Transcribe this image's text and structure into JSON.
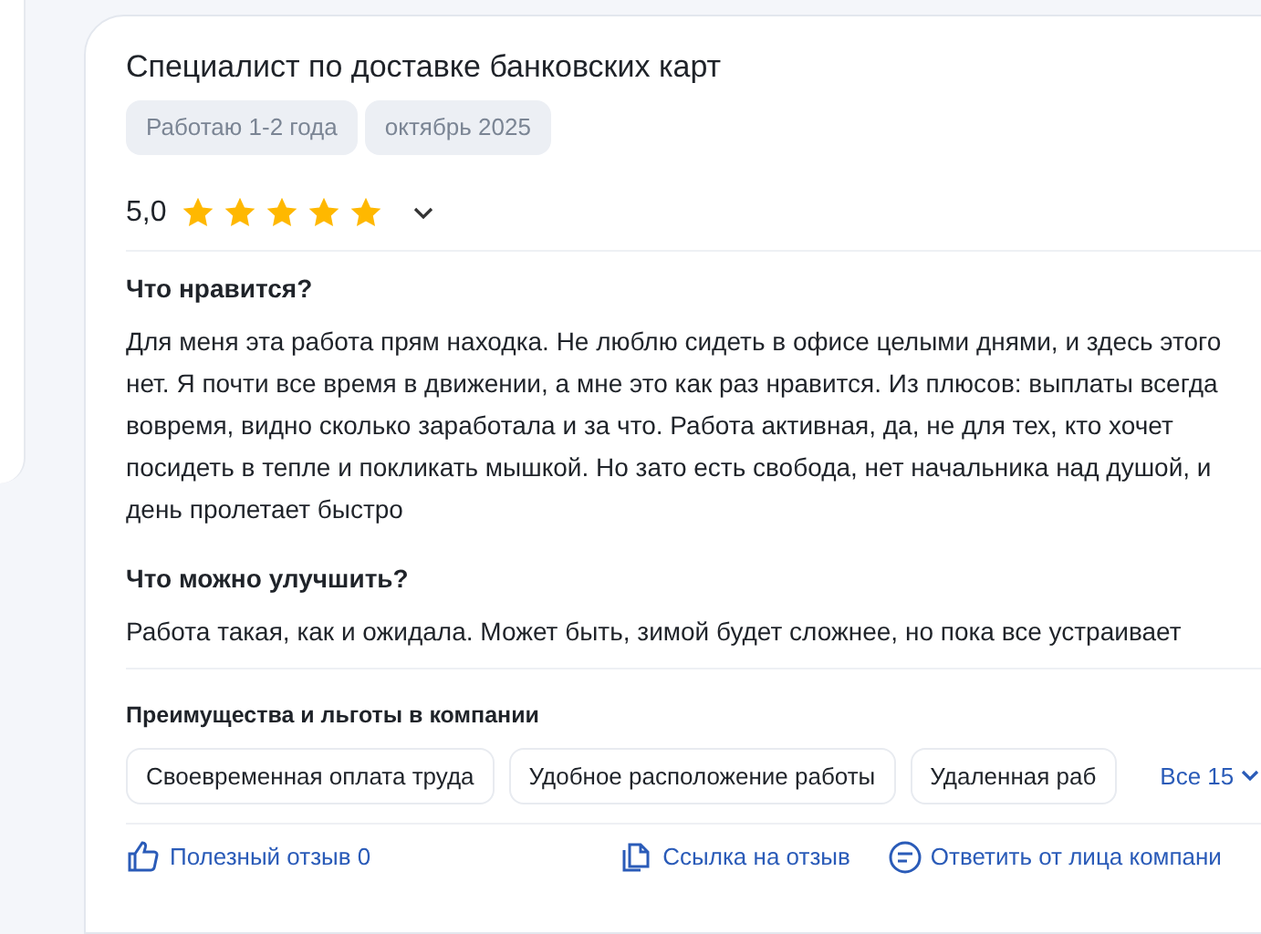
{
  "review": {
    "title": "Специалист по доставке банковских карт",
    "tags": [
      "Работаю 1-2 года",
      "октябрь 2025"
    ],
    "rating": {
      "value": "5,0",
      "stars": 5
    },
    "sections": [
      {
        "heading": "Что нравится?",
        "text": "Для меня эта работа прям находка. Не люблю сидеть в офисе целыми днями, и здесь этого нет. Я почти все время в движении, а мне это как раз нравится. Из плюсов: выплаты всегда вовремя, видно сколько заработала и за что. Работа активная, да, не для тех, кто хочет посидеть в тепле и покликать мышкой. Но зато есть свобода, нет начальника над душой, и день пролетает быстро"
      },
      {
        "heading": "Что можно улучшить?",
        "text": "Работа такая, как и ожидала. Может быть, зимой будет сложнее, но пока все устраивает"
      }
    ],
    "benefits": {
      "heading": "Преимущества и льготы в компании",
      "items": [
        "Своевременная оплата труда",
        "Удобное расположение работы",
        "Удаленная раб"
      ],
      "more": "Все 15"
    },
    "actions": [
      {
        "kind": "like",
        "label": "Полезный отзыв 0"
      },
      {
        "kind": "copy",
        "label": "Ссылка на отзыв"
      },
      {
        "kind": "reply",
        "label": "Ответить от лица компани"
      }
    ]
  }
}
